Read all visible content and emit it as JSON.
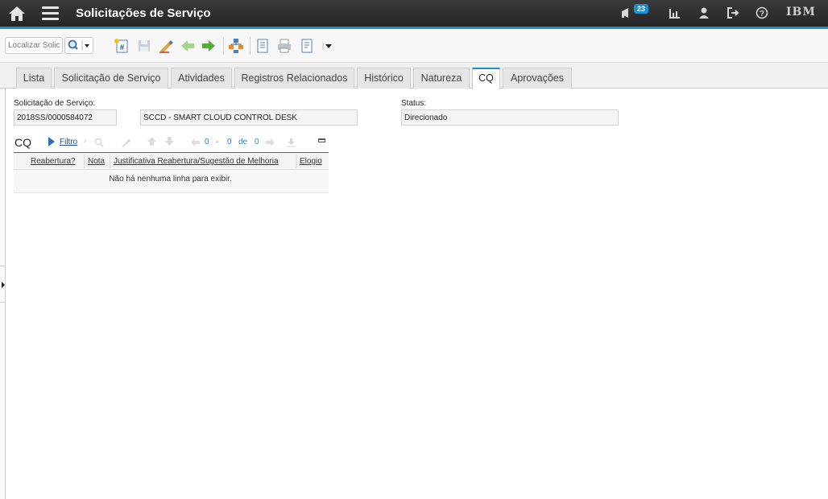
{
  "header": {
    "title": "Solicitações de Serviço",
    "notification_count": "23",
    "brand": "IBM",
    "icons": [
      "home-icon",
      "menu-icon",
      "megaphone-icon",
      "reports-icon",
      "user-icon",
      "logout-icon",
      "help-icon"
    ],
    "accent_color": "#1b8fd0"
  },
  "toolbar": {
    "search_placeholder": "Localizar Solic",
    "tools": [
      "new-record-icon",
      "save-icon",
      "clear-changes-icon",
      "previous-record-icon",
      "next-record-icon",
      "workflow-icon",
      "view-history-icon",
      "print-icon",
      "report-icon",
      "more-actions-icon"
    ]
  },
  "tabs": [
    "Lista",
    "Solicitação de Serviço",
    "Atividades",
    "Registros Relacionados",
    "Histórico",
    "Natureza",
    "CQ",
    "Aprovações"
  ],
  "active_tab": "CQ",
  "form": {
    "sr_label": "Solicitação de Serviço:",
    "sr_number": "2018SS/0000584072",
    "sr_description": "SCCD - SMART CLOUD CONTROL DESK",
    "status_label": "Status:",
    "status_value": "Direcionado"
  },
  "cq_table": {
    "title": "CQ",
    "filter_label": "Filtro",
    "pager": {
      "from": "0",
      "dash": "-",
      "to": "0",
      "of_label": "de",
      "total": "0"
    },
    "columns": [
      "Reabertura?",
      "Nota",
      "Justificativa Reabertura/Sugestão de Melhoria",
      "Elogio"
    ],
    "empty_message": "Não há nenhuma linha para exibir."
  }
}
